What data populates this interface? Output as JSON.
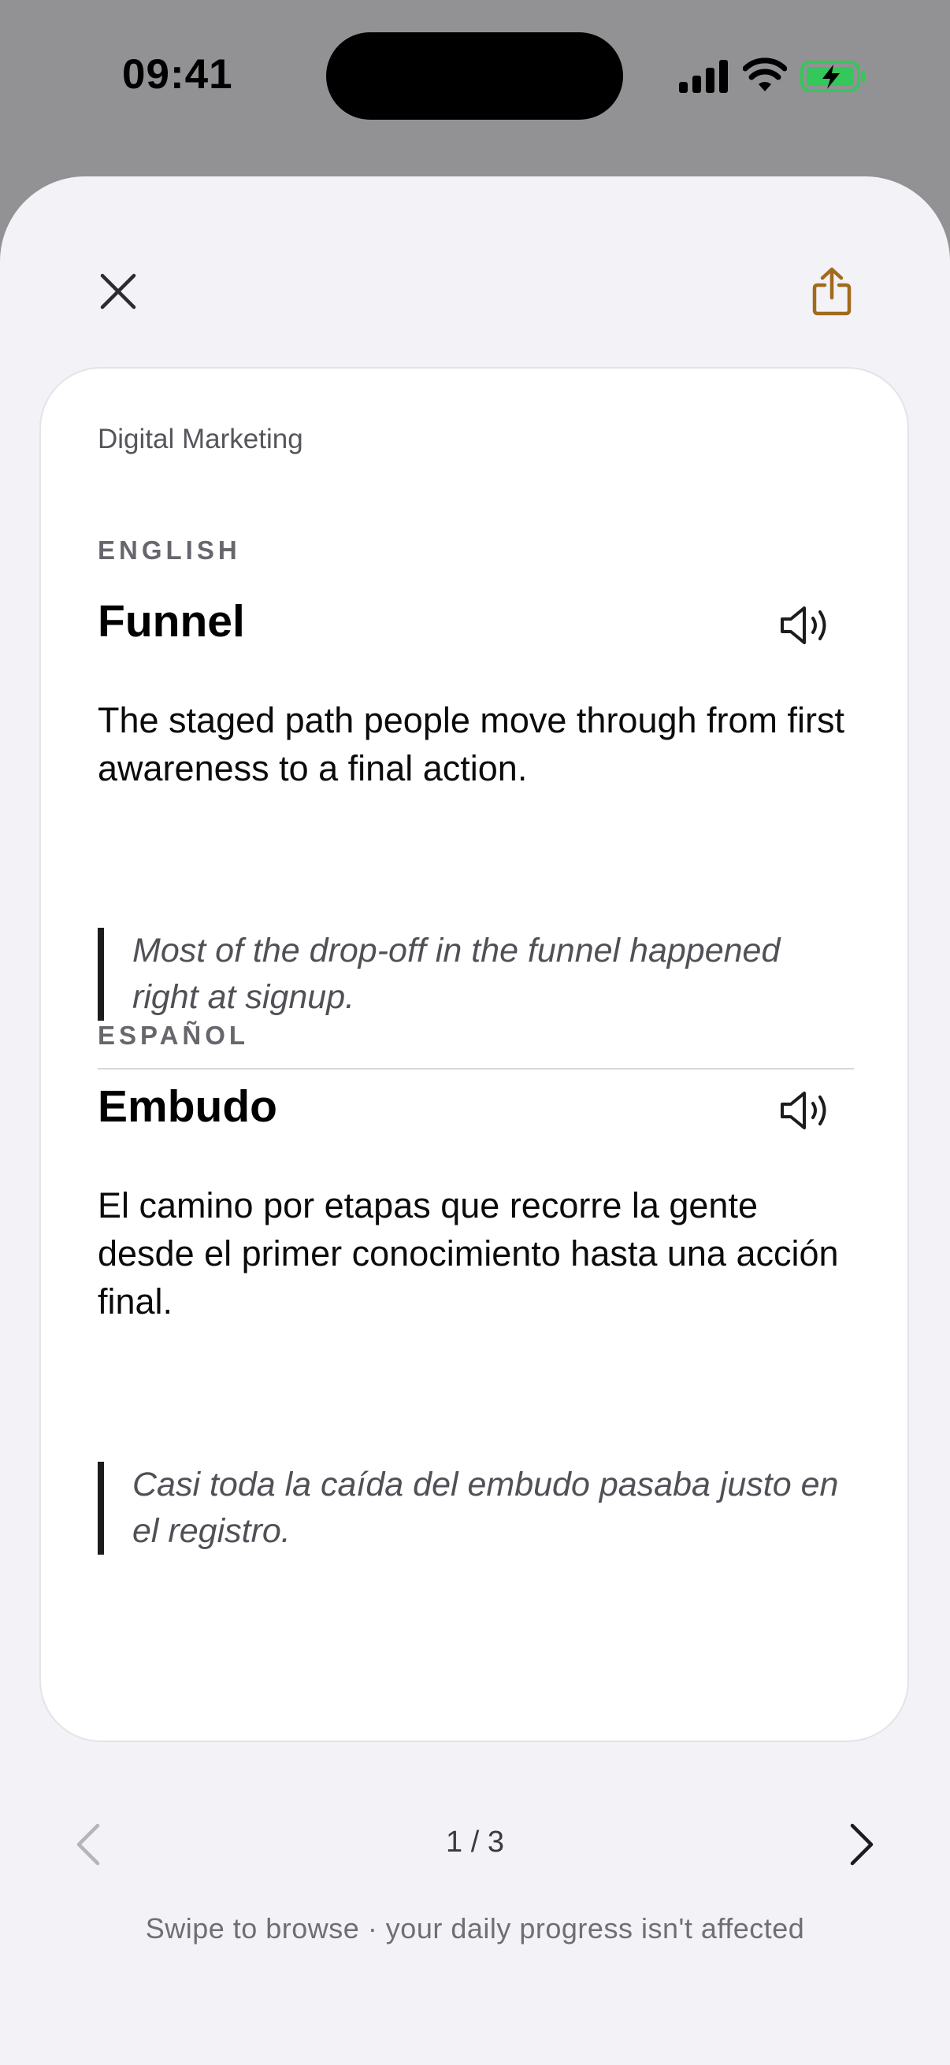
{
  "status_bar": {
    "time": "09:41",
    "battery_color": "#34c759"
  },
  "toolbar": {
    "close_icon": "close-icon",
    "share_icon": "share-icon",
    "accent_color": "#a26a1c"
  },
  "card": {
    "category": "Digital Marketing",
    "english": {
      "label": "ENGLISH",
      "term": "Funnel",
      "definition": "The staged path people move through from first awareness to a final action.",
      "example": "Most of the drop-off in the funnel happened right at signup."
    },
    "spanish": {
      "label": "ESPAÑOL",
      "term": "Embudo",
      "definition": "El camino por etapas que recorre la gente desde el primer conocimiento hasta una acción final.",
      "example": "Casi toda la caída del embudo pasaba justo en el registro."
    }
  },
  "pager": {
    "indicator": "1 / 3",
    "current": 1,
    "total": 3,
    "hint": "Swipe to browse · your daily progress isn't affected"
  }
}
